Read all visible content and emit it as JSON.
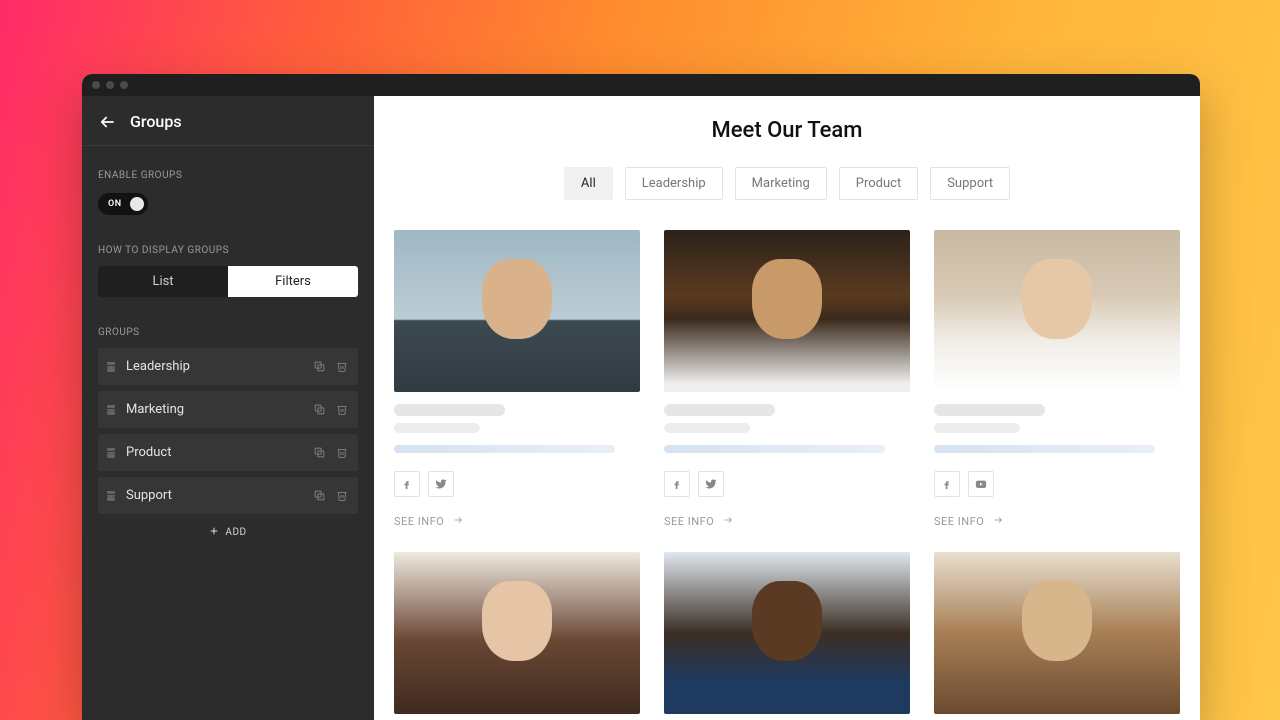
{
  "sidebar": {
    "title": "Groups",
    "enable_label": "ENABLE GROUPS",
    "toggle_state": "ON",
    "display_label": "HOW TO DISPLAY GROUPS",
    "seg_list": "List",
    "seg_filters": "Filters",
    "groups_label": "GROUPS",
    "items": [
      {
        "label": "Leadership"
      },
      {
        "label": "Marketing"
      },
      {
        "label": "Product"
      },
      {
        "label": "Support"
      }
    ],
    "add_label": "ADD"
  },
  "main": {
    "title": "Meet Our Team",
    "filters": [
      "All",
      "Leadership",
      "Marketing",
      "Product",
      "Support"
    ],
    "active_filter": "All",
    "see_info_label": "SEE INFO",
    "cards": [
      {
        "socials": [
          "facebook",
          "twitter"
        ]
      },
      {
        "socials": [
          "facebook",
          "twitter"
        ]
      },
      {
        "socials": [
          "facebook",
          "youtube"
        ]
      },
      {
        "socials": []
      },
      {
        "socials": []
      },
      {
        "socials": []
      }
    ]
  }
}
